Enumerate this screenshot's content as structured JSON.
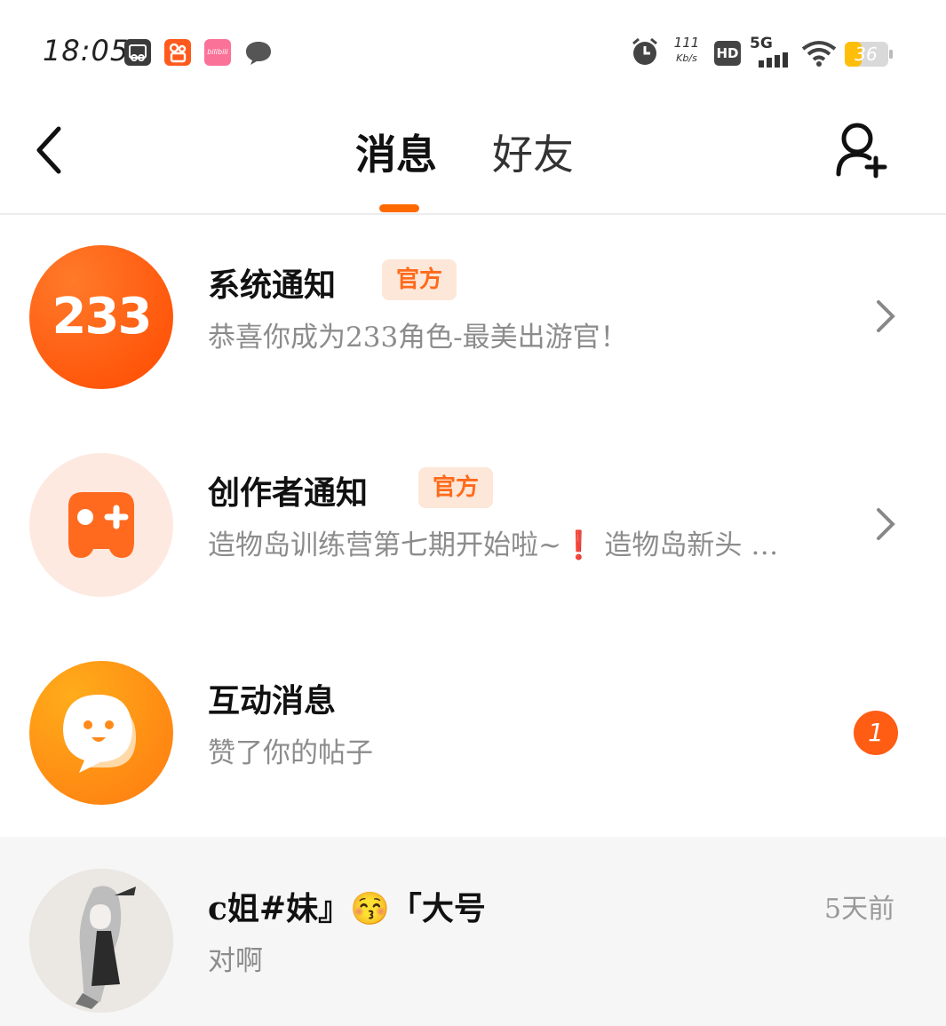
{
  "status_bar": {
    "time": "18:05",
    "net_speed_value": "111",
    "net_speed_unit": "Kb/s",
    "hd": "HD",
    "network": "5G",
    "battery": "36",
    "apps": [
      "screenshot-app-icon",
      "kuaishou-app-icon",
      "bilibili-app-icon",
      "chat-bubble-icon"
    ],
    "bilibili_text": "bilibili"
  },
  "header": {
    "tabs": [
      {
        "label": "消息",
        "active": true
      },
      {
        "label": "好友",
        "active": false
      }
    ],
    "accent": "#ff6a00"
  },
  "messages": [
    {
      "avatar_text": "233",
      "title": "系统通知",
      "badge": "官方",
      "subtitle": "恭喜你成为233角色-最美出游官！"
    },
    {
      "title": "创作者通知",
      "badge": "官方",
      "subtitle": "造物岛训练营第七期开始啦~❗ 造物岛新头 …"
    },
    {
      "title": "互动消息",
      "subtitle": "赞了你的帖子",
      "unread": "1"
    },
    {
      "title": "c姐#妹』😚「大号",
      "subtitle": "对啊",
      "time": "5天前"
    }
  ]
}
